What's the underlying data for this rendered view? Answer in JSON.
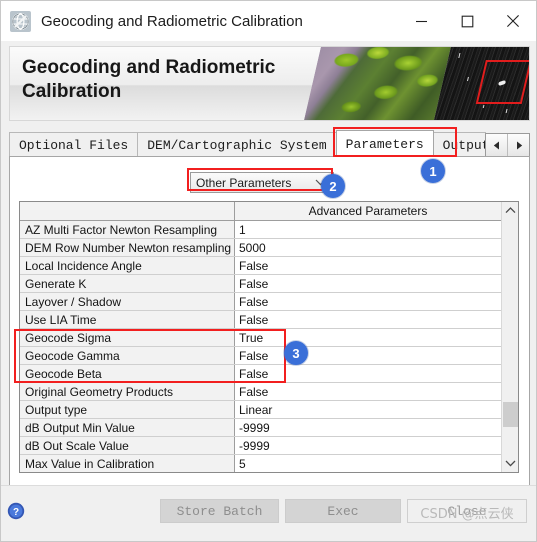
{
  "window": {
    "title": "Geocoding and Radiometric Calibration",
    "app_icon": "globe-icon",
    "controls": {
      "minimize": "minimize-icon",
      "maximize": "maximize-icon",
      "close": "close-icon"
    }
  },
  "banner": {
    "heading": "Geocoding and Radiometric Calibration"
  },
  "tabs": {
    "items": [
      {
        "label": "Optional Files",
        "active": false
      },
      {
        "label": "DEM/Cartographic System",
        "active": false
      },
      {
        "label": "Parameters",
        "active": true
      },
      {
        "label": "Output F",
        "active": false
      }
    ],
    "scroll_left": "triangle-left-icon",
    "scroll_right": "triangle-right-icon"
  },
  "panel": {
    "combo": {
      "value": "Other Parameters",
      "arrow_icon": "chevron-down-icon"
    },
    "table": {
      "header_name": "",
      "header_value": "Advanced Parameters",
      "rows": [
        {
          "name": "AZ Multi Factor Newton Resampling",
          "value": "1"
        },
        {
          "name": "DEM Row Number Newton resampling",
          "value": "5000"
        },
        {
          "name": "Local Incidence Angle",
          "value": "False"
        },
        {
          "name": "Generate K",
          "value": "False"
        },
        {
          "name": "Layover / Shadow",
          "value": "False"
        },
        {
          "name": "Use LIA Time",
          "value": "False"
        },
        {
          "name": "Geocode Sigma",
          "value": "True"
        },
        {
          "name": "Geocode Gamma",
          "value": "False"
        },
        {
          "name": "Geocode Beta",
          "value": "False"
        },
        {
          "name": "Original Geometry Products",
          "value": "False"
        },
        {
          "name": "Output type",
          "value": "Linear"
        },
        {
          "name": "dB Output Min Value",
          "value": "-9999"
        },
        {
          "name": "dB Out Scale Value",
          "value": "-9999"
        },
        {
          "name": "Max Value in Calibration",
          "value": "5"
        }
      ],
      "scrollbar": {
        "up_icon": "chevron-up-icon",
        "down_icon": "chevron-down-icon"
      }
    }
  },
  "footer": {
    "help_icon": "help-question-icon",
    "buttons": [
      {
        "label": "Store Batch",
        "name": "store-batch-button"
      },
      {
        "label": "Exec",
        "name": "exec-button"
      },
      {
        "label": "Close",
        "name": "close-button"
      }
    ],
    "watermark": "CSDN @点云侠"
  },
  "annotations": {
    "badges": [
      {
        "number": "1"
      },
      {
        "number": "2"
      },
      {
        "number": "3"
      }
    ],
    "highlight_color": "#f21f1f",
    "badge_color": "#3a6fd8"
  }
}
